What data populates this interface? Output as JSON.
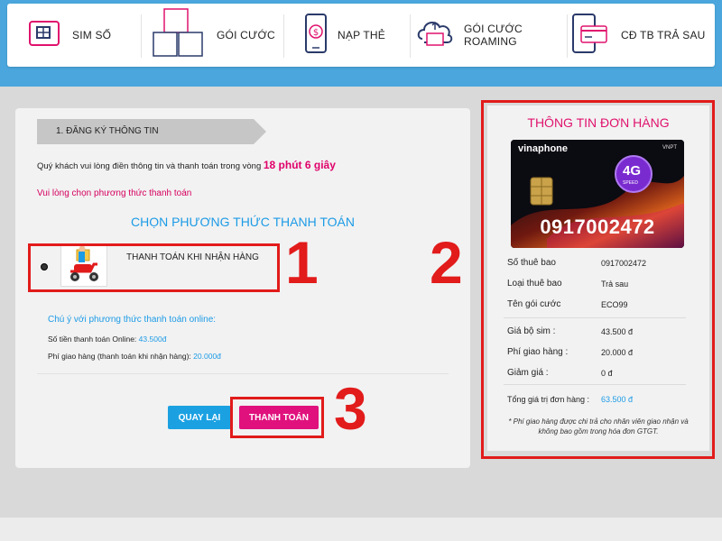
{
  "nav": {
    "items": [
      {
        "label": "SIM SỐ",
        "icon": "sim-card-icon"
      },
      {
        "label": "GÓI CƯỚC",
        "icon": "package-boxes-icon"
      },
      {
        "label": "NẠP THẺ",
        "icon": "mobile-topup-icon"
      },
      {
        "label": "GÓI CƯỚC ROAMING",
        "icon": "cloud-roaming-icon"
      },
      {
        "label": "CĐ TB TRẢ SAU",
        "icon": "credit-card-icon"
      }
    ]
  },
  "checkout": {
    "step_label": "1. ĐĂNG KÝ THÔNG TIN",
    "timer_prefix": "Quý khách vui lòng điền thông tin và thanh toán trong vòng",
    "timer_value": "18 phút 6 giây",
    "choose_warning": "Vui lòng chọn phương thức thanh toán",
    "choose_title": "CHỌN PHƯƠNG THỨC THANH TOÁN",
    "payment_option": "THANH TOÁN KHI NHẬN HÀNG",
    "note_title": "Chú ý với phương thức thanh toán online:",
    "online_amount_label": "Số tiền thanh toán Online:",
    "online_amount_value": "43.500đ",
    "shipping_label": "Phí giao hàng (thanh toán khi nhận hàng):",
    "shipping_value": "20.000đ",
    "back_button": "QUAY LẠI",
    "pay_button": "THANH TOÁN"
  },
  "annotations": {
    "one": "1",
    "two": "2",
    "three": "3"
  },
  "order": {
    "title": "THÔNG TIN ĐƠN HÀNG",
    "card_brand": "vinaphone",
    "card_vnpt": "VNPT",
    "card_4g": "4G",
    "card_speed": "SPEED",
    "card_number": "0917002472",
    "rows": [
      {
        "label": "Số thuê bao",
        "value": "0917002472"
      },
      {
        "label": "Loại thuê bao",
        "value": "Trả sau"
      },
      {
        "label": "Tên gói cước",
        "value": "ECO99"
      }
    ],
    "price_rows": [
      {
        "label": "Giá bộ sim :",
        "value": "43.500 đ"
      },
      {
        "label": "Phí giao hàng :",
        "value": "20.000 đ"
      },
      {
        "label": "Giảm giá :",
        "value": "0 đ"
      }
    ],
    "total_label": "Tổng giá trị đơn hàng :",
    "total_value": "63.500 đ",
    "footnote": "* Phí giao hàng được chi trả cho nhân viên giao nhận và không bao gồm trong hóa đơn GTGT."
  },
  "colors": {
    "accent_blue": "#1c9be6",
    "accent_pink": "#e0117d",
    "annotation_red": "#e21b1b",
    "topbar_blue": "#4aa6dc"
  }
}
